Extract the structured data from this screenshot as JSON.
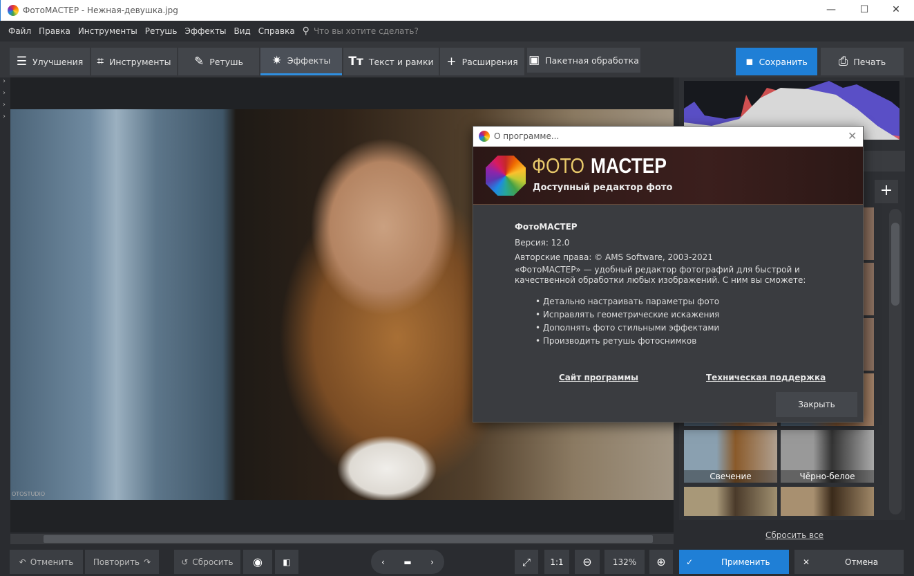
{
  "window": {
    "title": "ФотоМАСТЕР - Нежная-девушка.jpg",
    "minimize": "—",
    "maximize": "☐",
    "close": "✕"
  },
  "menu": {
    "items": [
      "Файл",
      "Правка",
      "Инструменты",
      "Ретушь",
      "Эффекты",
      "Вид",
      "Справка"
    ],
    "search_placeholder": "Что вы хотите сделать?"
  },
  "tabs": [
    {
      "label": "Улучшения",
      "icon": "sliders-icon"
    },
    {
      "label": "Инструменты",
      "icon": "crop-icon"
    },
    {
      "label": "Ретушь",
      "icon": "brush-icon"
    },
    {
      "label": "Эффекты",
      "icon": "magic-wand-icon",
      "active": true
    },
    {
      "label": "Текст и рамки",
      "icon": "text-icon"
    },
    {
      "label": "Расширения",
      "icon": "plus-icon"
    },
    {
      "label": "Пакетная обработка",
      "icon": "image-icon"
    }
  ],
  "actions": {
    "save": "Сохранить",
    "print": "Печать"
  },
  "photo": {
    "watermark": "OTOSTUDIO"
  },
  "effects": {
    "thumbs": [
      "Свечение",
      "Чёрно-белое"
    ],
    "reset_all": "Сбросить все",
    "apply": "Применить",
    "cancel": "Отмена"
  },
  "bottom": {
    "undo": "Отменить",
    "redo": "Повторить",
    "reset": "Сбросить",
    "one_to_one": "1:1",
    "zoom": "132%"
  },
  "dialog": {
    "title": "О программе...",
    "brand_light": "ФОТО",
    "brand_bold": "МАСТЕР",
    "tagline": "Доступный редактор фото",
    "app_name": "ФотоМАСТЕР",
    "version": "Версия: 12.0",
    "copyright": "Авторские права: © AMS Software, 2003-2021",
    "desc1": "«ФотоМАСТЕР» — удобный редактор фотографий для быстрой и",
    "desc2": "качественной обработки любых изображений. С ним вы сможете:",
    "features": [
      "• Детально настраивать параметры фото",
      "• Исправлять геометрические искажения",
      "• Дополнять фото стильными эффектами",
      "• Производить ретушь фотоснимков"
    ],
    "site_link": "Сайт программы",
    "support_link": "Техническая поддержка",
    "close": "Закрыть"
  },
  "colors": {
    "accent": "#1f7fd6",
    "brand_gold": "#e8c96a"
  }
}
